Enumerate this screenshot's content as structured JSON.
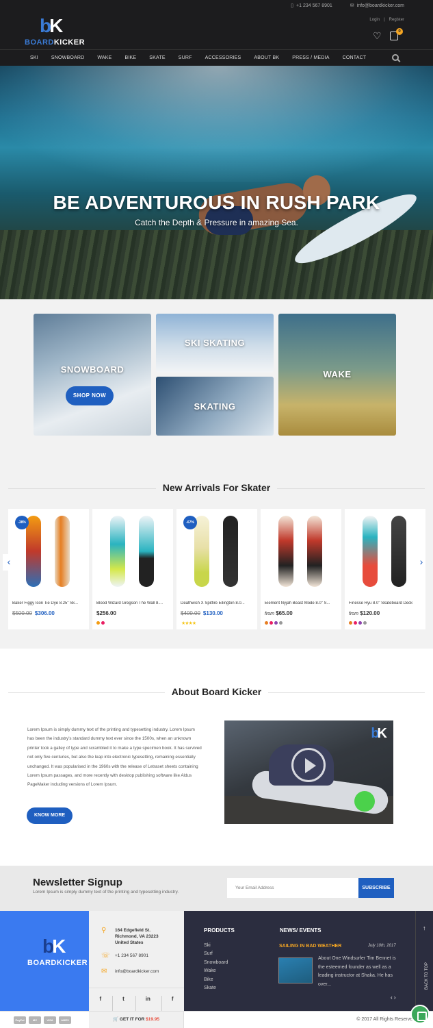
{
  "contact": {
    "phone": "+1 234 567 8901",
    "email": "info@boardkicker.com",
    "phone_icon": "phone-icon",
    "email_icon": "mail-icon"
  },
  "brand": {
    "mark_b": "b",
    "mark_k": "K",
    "word_a": "BOARD",
    "word_b": "KICKER",
    "brand_color": "#3a7bd5"
  },
  "auth": {
    "login": "Login",
    "sep": "|",
    "register": "Register"
  },
  "cart": {
    "count": "0"
  },
  "nav": {
    "items": [
      "SKI",
      "SNOWBOARD",
      "WAKE",
      "BIKE",
      "SKATE",
      "SURF",
      "ACCESSORIES",
      "ABOUT BK",
      "PRESS / MEDIA",
      "CONTACT"
    ],
    "search_icon": "search-icon"
  },
  "hero": {
    "title": "BE ADVENTUROUS IN RUSH PARK",
    "subtitle": "Catch the Depth & Pressure in amazing Sea."
  },
  "categories": {
    "snowboard": "SNOWBOARD",
    "shop_now": "SHOP NOW",
    "ski": "SKI SKATING",
    "skating": "SKATING",
    "wake": "WAKE"
  },
  "arrivals": {
    "title": "New Arrivals For Skater",
    "products": [
      {
        "badge": "-38%",
        "name": "Baker Figgy Icon Tie Dye 8.25\" Sk...",
        "old_price": "$500.00",
        "price": "$306.00",
        "colors": []
      },
      {
        "badge": "",
        "name": "Blood Wizard Gregson The Wall 8....",
        "old_price": "",
        "price": "$256.00",
        "colors": [
          "#f39c12",
          "#e91e63"
        ]
      },
      {
        "badge": "-67%",
        "name": "Deathwish X Spitfire Ellington 8.0...",
        "old_price": "$400.00",
        "price": "$130.00",
        "colors": [],
        "stars": "★★★★"
      },
      {
        "badge": "",
        "name": "Element Nyjah Beast Mode 8.0\" S...",
        "from": "from",
        "old_price": "",
        "price": "$65.00",
        "colors": [
          "#e67e22",
          "#e91e63",
          "#8e44ad",
          "#999999"
        ]
      },
      {
        "badge": "",
        "name": "Finesse Ryu 8.0\" Skateboard Deck",
        "from": "from",
        "old_price": "",
        "price": "$120.00",
        "colors": [
          "#e67e22",
          "#e91e63",
          "#8e44ad",
          "#999999"
        ]
      }
    ],
    "prev_icon": "chevron-left-icon",
    "next_icon": "chevron-right-icon"
  },
  "about": {
    "title": "About Board Kicker",
    "text": "Lorem Ipsum is simply dummy text of the printing and typesetting industry. Lorem Ipsum has been the industry's standard dummy text ever since the 1500s, when an unknown printer took a galley of type and scrambled it to make a type specimen book. It has survived not only five centuries, but also the leap into electronic typesetting, remaining essentially unchanged. It was popularised in the 1960s with the release of Letraset sheets containing Lorem Ipsum passages, and more recently with desktop publishing software like Aldus PageMaker including versions of Lorem Ipsum.",
    "button": "KNOW MORE"
  },
  "newsletter": {
    "title": "Newsletter Signup",
    "subtitle": "Lorem Ipsum is simply dummy text of the printing and typesetting industry.",
    "placeholder": "Your Email Address",
    "button": "SUBSCRIBE"
  },
  "footer": {
    "address_line1": "164 Edgefield St.",
    "address_line2": "Richmond, VA 23223",
    "address_line3": "United States",
    "phone": "+1 234 567 8901",
    "email": "info@boardkicker.com",
    "social": [
      "f",
      "t",
      "in",
      "f"
    ],
    "products_title": "PRODUCTS",
    "products": [
      "Ski",
      "Surf",
      "Snowboard",
      "Wake",
      "Bike",
      "Skate"
    ],
    "news_title": "NEWS/ EVENTS",
    "news_headline": "SAILING IN BAD WEATHER",
    "news_date": "July 10th, 2017",
    "news_text": "About One Windsurfer Tim Bennet is the esteemed founder as well as a leading instructor at Shaka. He has over...",
    "news_nav": "‹ ›",
    "back_to_top": "BACK TO TOP"
  },
  "bottom": {
    "payments": [
      "PayPal",
      "MC",
      "VISA",
      "AMEX"
    ],
    "get_it": "GET IT FOR",
    "get_price": "$19.95",
    "copyright": "© 2017 All Rights Reserved"
  }
}
